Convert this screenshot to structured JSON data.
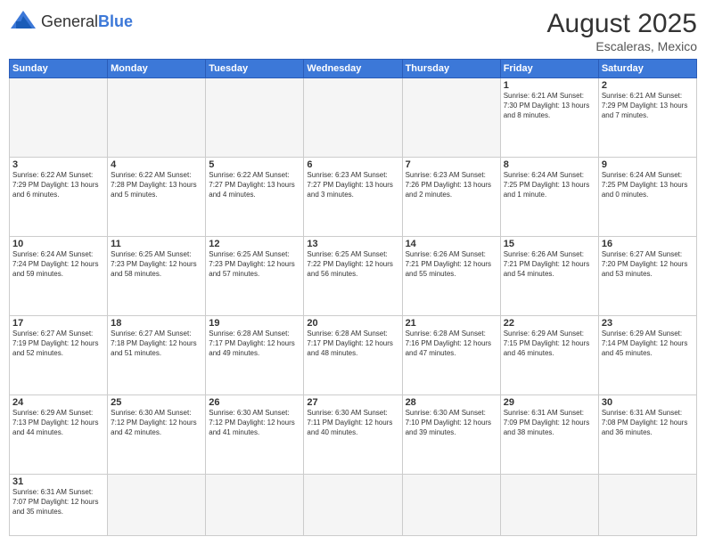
{
  "header": {
    "logo_general": "General",
    "logo_blue": "Blue",
    "title": "August 2025",
    "subtitle": "Escaleras, Mexico"
  },
  "weekdays": [
    "Sunday",
    "Monday",
    "Tuesday",
    "Wednesday",
    "Thursday",
    "Friday",
    "Saturday"
  ],
  "weeks": [
    [
      {
        "day": "",
        "info": ""
      },
      {
        "day": "",
        "info": ""
      },
      {
        "day": "",
        "info": ""
      },
      {
        "day": "",
        "info": ""
      },
      {
        "day": "",
        "info": ""
      },
      {
        "day": "1",
        "info": "Sunrise: 6:21 AM\nSunset: 7:30 PM\nDaylight: 13 hours\nand 8 minutes."
      },
      {
        "day": "2",
        "info": "Sunrise: 6:21 AM\nSunset: 7:29 PM\nDaylight: 13 hours\nand 7 minutes."
      }
    ],
    [
      {
        "day": "3",
        "info": "Sunrise: 6:22 AM\nSunset: 7:29 PM\nDaylight: 13 hours\nand 6 minutes."
      },
      {
        "day": "4",
        "info": "Sunrise: 6:22 AM\nSunset: 7:28 PM\nDaylight: 13 hours\nand 5 minutes."
      },
      {
        "day": "5",
        "info": "Sunrise: 6:22 AM\nSunset: 7:27 PM\nDaylight: 13 hours\nand 4 minutes."
      },
      {
        "day": "6",
        "info": "Sunrise: 6:23 AM\nSunset: 7:27 PM\nDaylight: 13 hours\nand 3 minutes."
      },
      {
        "day": "7",
        "info": "Sunrise: 6:23 AM\nSunset: 7:26 PM\nDaylight: 13 hours\nand 2 minutes."
      },
      {
        "day": "8",
        "info": "Sunrise: 6:24 AM\nSunset: 7:25 PM\nDaylight: 13 hours\nand 1 minute."
      },
      {
        "day": "9",
        "info": "Sunrise: 6:24 AM\nSunset: 7:25 PM\nDaylight: 13 hours\nand 0 minutes."
      }
    ],
    [
      {
        "day": "10",
        "info": "Sunrise: 6:24 AM\nSunset: 7:24 PM\nDaylight: 12 hours\nand 59 minutes."
      },
      {
        "day": "11",
        "info": "Sunrise: 6:25 AM\nSunset: 7:23 PM\nDaylight: 12 hours\nand 58 minutes."
      },
      {
        "day": "12",
        "info": "Sunrise: 6:25 AM\nSunset: 7:23 PM\nDaylight: 12 hours\nand 57 minutes."
      },
      {
        "day": "13",
        "info": "Sunrise: 6:25 AM\nSunset: 7:22 PM\nDaylight: 12 hours\nand 56 minutes."
      },
      {
        "day": "14",
        "info": "Sunrise: 6:26 AM\nSunset: 7:21 PM\nDaylight: 12 hours\nand 55 minutes."
      },
      {
        "day": "15",
        "info": "Sunrise: 6:26 AM\nSunset: 7:21 PM\nDaylight: 12 hours\nand 54 minutes."
      },
      {
        "day": "16",
        "info": "Sunrise: 6:27 AM\nSunset: 7:20 PM\nDaylight: 12 hours\nand 53 minutes."
      }
    ],
    [
      {
        "day": "17",
        "info": "Sunrise: 6:27 AM\nSunset: 7:19 PM\nDaylight: 12 hours\nand 52 minutes."
      },
      {
        "day": "18",
        "info": "Sunrise: 6:27 AM\nSunset: 7:18 PM\nDaylight: 12 hours\nand 51 minutes."
      },
      {
        "day": "19",
        "info": "Sunrise: 6:28 AM\nSunset: 7:17 PM\nDaylight: 12 hours\nand 49 minutes."
      },
      {
        "day": "20",
        "info": "Sunrise: 6:28 AM\nSunset: 7:17 PM\nDaylight: 12 hours\nand 48 minutes."
      },
      {
        "day": "21",
        "info": "Sunrise: 6:28 AM\nSunset: 7:16 PM\nDaylight: 12 hours\nand 47 minutes."
      },
      {
        "day": "22",
        "info": "Sunrise: 6:29 AM\nSunset: 7:15 PM\nDaylight: 12 hours\nand 46 minutes."
      },
      {
        "day": "23",
        "info": "Sunrise: 6:29 AM\nSunset: 7:14 PM\nDaylight: 12 hours\nand 45 minutes."
      }
    ],
    [
      {
        "day": "24",
        "info": "Sunrise: 6:29 AM\nSunset: 7:13 PM\nDaylight: 12 hours\nand 44 minutes."
      },
      {
        "day": "25",
        "info": "Sunrise: 6:30 AM\nSunset: 7:12 PM\nDaylight: 12 hours\nand 42 minutes."
      },
      {
        "day": "26",
        "info": "Sunrise: 6:30 AM\nSunset: 7:12 PM\nDaylight: 12 hours\nand 41 minutes."
      },
      {
        "day": "27",
        "info": "Sunrise: 6:30 AM\nSunset: 7:11 PM\nDaylight: 12 hours\nand 40 minutes."
      },
      {
        "day": "28",
        "info": "Sunrise: 6:30 AM\nSunset: 7:10 PM\nDaylight: 12 hours\nand 39 minutes."
      },
      {
        "day": "29",
        "info": "Sunrise: 6:31 AM\nSunset: 7:09 PM\nDaylight: 12 hours\nand 38 minutes."
      },
      {
        "day": "30",
        "info": "Sunrise: 6:31 AM\nSunset: 7:08 PM\nDaylight: 12 hours\nand 36 minutes."
      }
    ],
    [
      {
        "day": "31",
        "info": "Sunrise: 6:31 AM\nSunset: 7:07 PM\nDaylight: 12 hours\nand 35 minutes."
      },
      {
        "day": "",
        "info": ""
      },
      {
        "day": "",
        "info": ""
      },
      {
        "day": "",
        "info": ""
      },
      {
        "day": "",
        "info": ""
      },
      {
        "day": "",
        "info": ""
      },
      {
        "day": "",
        "info": ""
      }
    ]
  ]
}
